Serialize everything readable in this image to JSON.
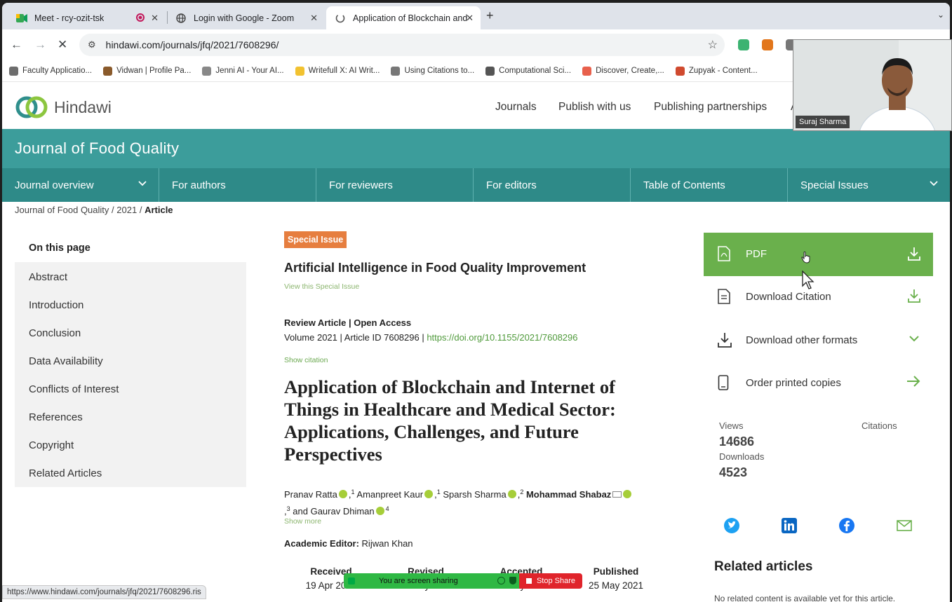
{
  "browser": {
    "tabs": [
      {
        "title": "Meet - rcy-ozit-tsk",
        "close": "✕"
      },
      {
        "title": "Login with Google - Zoom",
        "close": "✕"
      },
      {
        "title": "Application of Blockchain and",
        "close": "✕"
      }
    ],
    "new_tab": "+",
    "url": "hindawi.com/journals/jfq/2021/7608296/",
    "bookmarks": [
      {
        "label": "Faculty Applicatio...",
        "color": "#6d6d6d"
      },
      {
        "label": "Vidwan | Profile Pa...",
        "color": "#8a5a2b"
      },
      {
        "label": "Jenni AI - Your AI...",
        "color": "#888888"
      },
      {
        "label": "Writefull X: AI Writ...",
        "color": "#f2c230"
      },
      {
        "label": "Using Citations to...",
        "color": "#777777"
      },
      {
        "label": "Computational Sci...",
        "color": "#555555"
      },
      {
        "label": "Discover, Create,...",
        "color": "#e8604c"
      },
      {
        "label": "Zupyak - Content...",
        "color": "#d04a2f"
      }
    ],
    "status_url": "https://www.hindawi.com/journals/jfq/2021/7608296.ris"
  },
  "site": {
    "logo": "Hindawi",
    "nav": [
      "Journals",
      "Publish with us",
      "Publishing partnerships",
      "A"
    ],
    "journal_title": "Journal of Food Quality",
    "journal_nav": [
      "Journal overview",
      "For authors",
      "For reviewers",
      "For editors",
      "Table of Contents",
      "Special Issues"
    ]
  },
  "breadcrumb": {
    "journal": "Journal of Food Quality",
    "year": "2021",
    "current": "Article",
    "sep": "/"
  },
  "toc": {
    "title": "On this page",
    "items": [
      "Abstract",
      "Introduction",
      "Conclusion",
      "Data Availability",
      "Conflicts of Interest",
      "References",
      "Copyright",
      "Related Articles"
    ]
  },
  "article": {
    "badge": "Special Issue",
    "special_issue_title": "Artificial Intelligence in Food Quality Improvement",
    "view_special_issue": "View this Special Issue",
    "type": "Review Article | Open Access",
    "meta_prefix": "Volume 2021 | Article ID 7608296 | ",
    "doi": "https://doi.org/10.1155/2021/7608296",
    "show_citation": "Show citation",
    "title": "Application of Blockchain and Internet of Things in Healthcare and Medical Sector: Applications, Challenges, and Future Perspectives",
    "authors": [
      {
        "name": "Pranav Ratta",
        "sup": "1"
      },
      {
        "name": "Amanpreet Kaur",
        "sup": "1"
      },
      {
        "name": "Sparsh Sharma",
        "sup": "2"
      },
      {
        "name": "Mohammad Shabaz",
        "sup": "3"
      },
      {
        "name": "Gaurav Dhiman",
        "sup": "4"
      }
    ],
    "and": "and",
    "show_more": "Show more",
    "editor_label": "Academic Editor:",
    "editor_name": "Rijwan Khan",
    "dates": [
      {
        "label": "Received",
        "value": "19 Apr 2021"
      },
      {
        "label": "Revised",
        "value": "01 May 2021"
      },
      {
        "label": "Accepted",
        "value": "08 May 2021"
      },
      {
        "label": "Published",
        "value": "25 May 2021"
      }
    ]
  },
  "sidebar": {
    "pdf": "PDF",
    "download_citation": "Download Citation",
    "download_other": "Download other formats",
    "order_printed": "Order printed copies",
    "views_label": "Views",
    "views": "14686",
    "citations_label": "Citations",
    "downloads_label": "Downloads",
    "downloads": "4523",
    "related_title": "Related articles",
    "related_none": "No related content is available yet for this article."
  },
  "zoom": {
    "sharing": "You are screen sharing",
    "stop": "Stop Share",
    "participant": "Suraj Sharma"
  },
  "colors": {
    "teal": "#3c9d9b",
    "teal_dark": "#2e8a88",
    "green": "#6ab04c",
    "orange": "#e67e3f"
  }
}
